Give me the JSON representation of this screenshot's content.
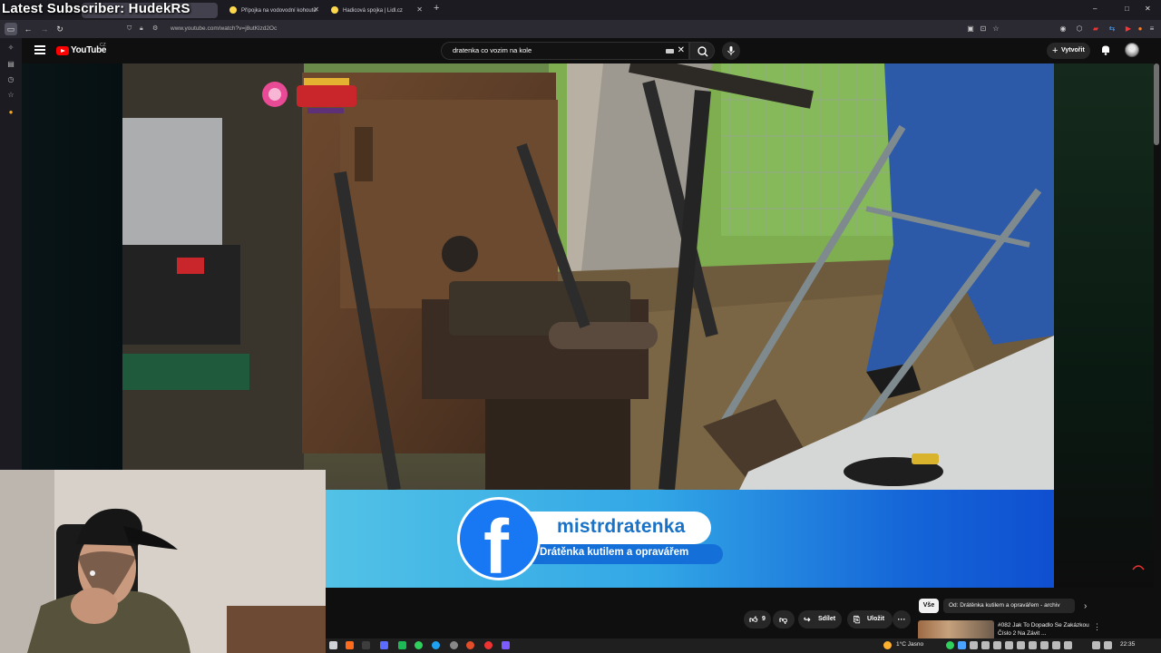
{
  "overlay": {
    "title": "Latest Subscriber: HudekRS"
  },
  "browser": {
    "tabs": [
      {
        "label": "Přípojka na vodovodní kohoutu"
      },
      {
        "label": "Hadicová spojka | Lidl.cz"
      }
    ],
    "new_tab": "+",
    "url": "www.youtube.com/watch?v=j8utKlzd2Oc",
    "window_controls": {
      "minimize": "–",
      "maximize": "□",
      "close": "✕"
    }
  },
  "youtube": {
    "logo_text": "YouTube",
    "logo_region": "CZ",
    "search_value": "dratenka co vozim na kole",
    "create_label": "Vytvořit"
  },
  "video": {
    "banner": {
      "name": "mistrdratenka",
      "subtitle": "Drátěnka kutilem a opravářem",
      "fb_letter": "f"
    }
  },
  "actions": {
    "like_count": "9",
    "share_label": "Sdílet",
    "save_label": "Uložit",
    "more": "···"
  },
  "related": {
    "chips": [
      "Vše",
      "Od: Drátěnka kutilem a opravářem - archiv"
    ],
    "next_chevron": "›",
    "item_title": "#082 Jak To Dopadlo Se Zakázkou Číslo 2 Na Závit ...",
    "item_more": "⋮"
  },
  "taskbar": {
    "weather": "1°C  Jasno",
    "time": "22:35"
  }
}
